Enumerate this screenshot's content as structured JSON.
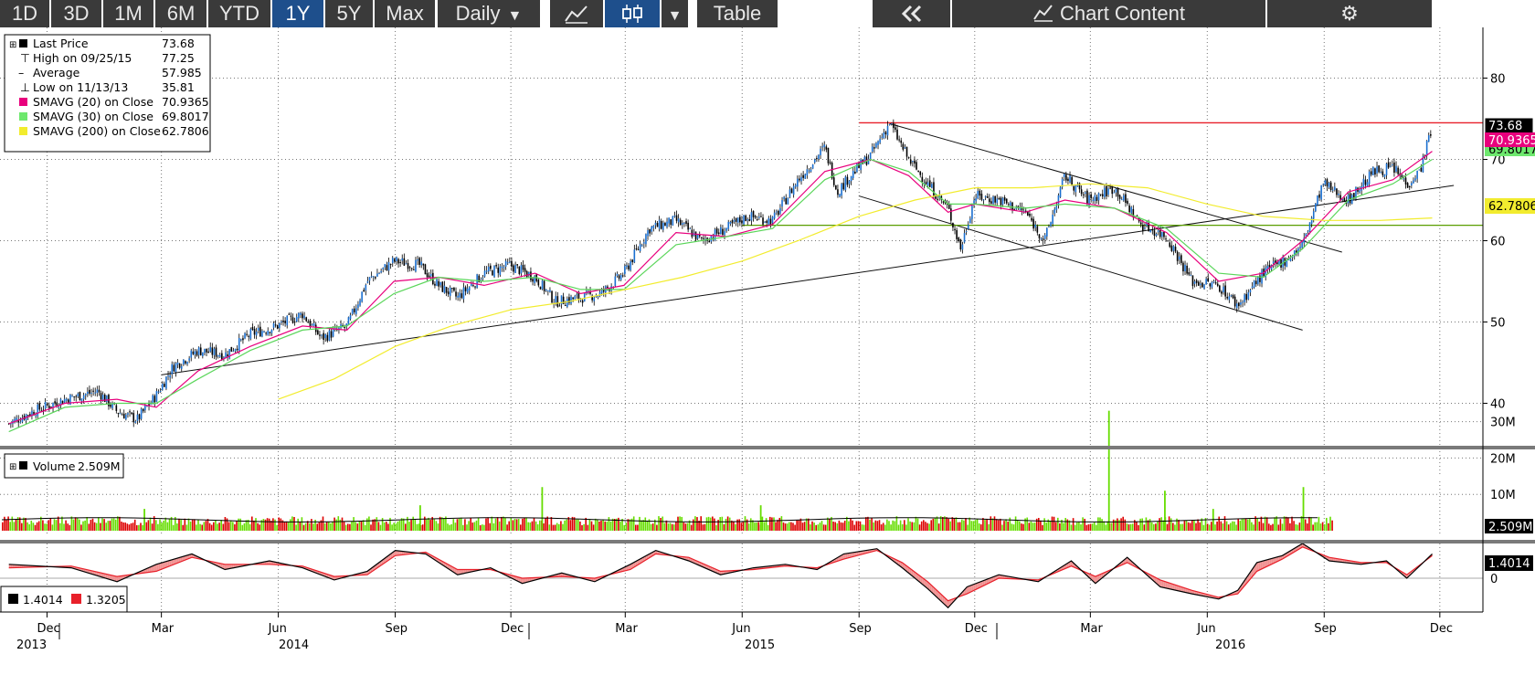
{
  "toolbar": {
    "ranges": [
      "1D",
      "3D",
      "1M",
      "6M",
      "YTD",
      "1Y",
      "5Y",
      "Max"
    ],
    "active_range": "1Y",
    "frequency": "Daily",
    "line_icon": "line-chart-icon",
    "candle_icon": "candlestick-icon",
    "dropdown_icon": "caret-down-icon",
    "table_label": "Table",
    "collapse_icon": "double-chevron-left-icon",
    "chart_content_label": "Chart Content",
    "chart_content_icon": "chart-icon",
    "settings_icon": "gear-icon"
  },
  "colors": {
    "price": "#000000",
    "sma20": "#e8007d",
    "sma30": "#5bd65b",
    "sma200": "#f2ec2e",
    "resistance": "#e8202a",
    "support": "#5a9e00",
    "macd": "#000000",
    "signal": "#e8202a",
    "volume_up": "#66dd00",
    "volume_down": "#dd0000"
  },
  "legend": {
    "last_price": {
      "label": "Last Price",
      "value": "73.68"
    },
    "high": {
      "label": "High on 09/25/15",
      "value": "77.25"
    },
    "average": {
      "label": "Average",
      "value": "57.985"
    },
    "low": {
      "label": "Low on 11/13/13",
      "value": "35.81"
    },
    "sma20": {
      "label": "SMAVG (20) on Close",
      "value": "70.9365"
    },
    "sma30": {
      "label": "SMAVG (30) on Close",
      "value": "69.8017"
    },
    "sma200": {
      "label": "SMAVG (200) on Close",
      "value": "62.7806"
    }
  },
  "volume_legend": {
    "label": "Volume",
    "value": "2.509M"
  },
  "macd_legend": {
    "macd_value": "1.4014",
    "signal_value": "1.3205"
  },
  "tags": {
    "last_price": "73.68",
    "sma20": "70.9365",
    "sma30": "69.8017",
    "sma200": "62.7806",
    "volume": "2.509M",
    "macd": "1.4014"
  },
  "chart_data": [
    {
      "type": "line",
      "panel": "price",
      "x_tick_labels": [
        "Dec",
        "Mar",
        "Jun",
        "Sep",
        "Dec",
        "Mar",
        "Jun",
        "Sep",
        "Dec",
        "Mar",
        "Jun",
        "Sep",
        "Dec"
      ],
      "year_labels": [
        "2013",
        "2014",
        "2015",
        "2016"
      ],
      "y_ticks": [
        40,
        50,
        60,
        70,
        80
      ],
      "ylim": [
        34,
        83
      ],
      "grid": true,
      "legend_position": "top-left",
      "series": [
        {
          "name": "Last Price",
          "color": "#000000",
          "x": [
            "2013-11-01",
            "2013-11-20",
            "2013-12-15",
            "2014-01-10",
            "2014-01-25",
            "2014-02-10",
            "2014-02-25",
            "2014-03-10",
            "2014-03-30",
            "2014-04-20",
            "2014-05-10",
            "2014-05-31",
            "2014-06-20",
            "2014-07-05",
            "2014-07-25",
            "2014-08-10",
            "2014-08-31",
            "2014-09-20",
            "2014-10-05",
            "2014-10-20",
            "2014-11-10",
            "2014-11-30",
            "2014-12-20",
            "2015-01-05",
            "2015-01-25",
            "2015-02-10",
            "2015-02-28",
            "2015-03-20",
            "2015-04-10",
            "2015-04-30",
            "2015-05-20",
            "2015-06-05",
            "2015-06-25",
            "2015-07-15",
            "2015-08-05",
            "2015-08-15",
            "2015-08-25",
            "2015-09-10",
            "2015-09-25",
            "2015-10-10",
            "2015-10-25",
            "2015-11-10",
            "2015-11-20",
            "2015-12-01",
            "2015-12-20",
            "2016-01-10",
            "2016-01-25",
            "2016-02-10",
            "2016-02-28",
            "2016-03-20",
            "2016-04-10",
            "2016-04-30",
            "2016-05-20",
            "2016-06-10",
            "2016-06-25",
            "2016-07-15",
            "2016-08-05",
            "2016-08-15",
            "2016-08-31",
            "2016-09-20",
            "2016-10-10",
            "2016-10-25",
            "2016-11-05",
            "2016-11-15",
            "2016-11-25"
          ],
          "values": [
            37.5,
            39,
            40.5,
            41.5,
            39,
            38,
            41,
            44.5,
            46.5,
            46,
            48.5,
            49.5,
            51,
            48,
            49.5,
            55,
            57.5,
            57,
            54.5,
            53,
            56,
            57,
            55.5,
            52.5,
            53,
            53.5,
            56,
            61.5,
            62.5,
            60,
            61.5,
            63,
            62.5,
            67.5,
            71.5,
            66,
            68,
            70.5,
            74.5,
            70,
            67,
            64,
            59,
            65.5,
            65,
            63.5,
            60,
            68,
            65,
            66.5,
            62,
            60.5,
            55,
            54.5,
            52,
            56,
            58,
            59.5,
            67,
            65,
            68.5,
            69,
            67,
            68.5,
            74
          ]
        },
        {
          "name": "SMAVG (20) on Close",
          "color": "#e8007d",
          "x": [
            "2013-11-01",
            "2013-12-15",
            "2014-01-25",
            "2014-02-25",
            "2014-03-30",
            "2014-05-10",
            "2014-06-20",
            "2014-07-25",
            "2014-08-31",
            "2014-10-05",
            "2014-11-10",
            "2014-12-20",
            "2015-01-25",
            "2015-02-28",
            "2015-04-10",
            "2015-05-20",
            "2015-06-25",
            "2015-08-05",
            "2015-09-10",
            "2015-10-10",
            "2015-11-10",
            "2015-12-01",
            "2016-01-10",
            "2016-02-10",
            "2016-03-20",
            "2016-04-30",
            "2016-06-10",
            "2016-07-15",
            "2016-08-15",
            "2016-09-20",
            "2016-10-25",
            "2016-11-25"
          ],
          "values": [
            37.5,
            40,
            40.5,
            39.5,
            44,
            47,
            49.5,
            49,
            55,
            55.5,
            54.5,
            56,
            53.5,
            54.5,
            61,
            60.5,
            62,
            68.5,
            70,
            68,
            63.5,
            64.5,
            63.5,
            65,
            64,
            61,
            55,
            56,
            60,
            66,
            67.5,
            71
          ]
        },
        {
          "name": "SMAVG (30) on Close",
          "color": "#5bd65b",
          "x": [
            "2013-11-01",
            "2013-12-15",
            "2014-01-25",
            "2014-02-25",
            "2014-03-30",
            "2014-05-10",
            "2014-06-20",
            "2014-07-25",
            "2014-08-31",
            "2014-10-05",
            "2014-11-10",
            "2014-12-20",
            "2015-01-25",
            "2015-02-28",
            "2015-04-10",
            "2015-05-20",
            "2015-06-25",
            "2015-08-05",
            "2015-09-10",
            "2015-10-10",
            "2015-11-10",
            "2015-12-01",
            "2016-01-10",
            "2016-02-10",
            "2016-03-20",
            "2016-04-30",
            "2016-06-10",
            "2016-07-15",
            "2016-08-15",
            "2016-09-20",
            "2016-10-25",
            "2016-11-25"
          ],
          "values": [
            36.5,
            39.5,
            40,
            40,
            43,
            46.5,
            49,
            49.5,
            53.5,
            55.5,
            55,
            55.5,
            54,
            54,
            59.5,
            60.5,
            61.5,
            67.5,
            70,
            68.5,
            64.5,
            64.5,
            64,
            64.5,
            64,
            61.5,
            56,
            55.5,
            59,
            65,
            67,
            70
          ]
        },
        {
          "name": "SMAVG (200) on Close",
          "color": "#f2ec2e",
          "x": [
            "2014-06-01",
            "2014-07-15",
            "2014-09-01",
            "2014-10-15",
            "2014-12-01",
            "2015-01-15",
            "2015-03-01",
            "2015-04-15",
            "2015-06-01",
            "2015-07-15",
            "2015-09-01",
            "2015-10-15",
            "2015-12-01",
            "2016-01-15",
            "2016-03-01",
            "2016-04-15",
            "2016-06-01",
            "2016-07-15",
            "2016-09-01",
            "2016-10-15",
            "2016-11-25"
          ],
          "values": [
            40.5,
            43,
            47,
            49.5,
            51.5,
            52.5,
            54,
            55.5,
            57.5,
            60,
            63,
            65,
            66.5,
            66.5,
            67,
            66.5,
            64.5,
            63,
            62.5,
            62.5,
            62.8
          ]
        }
      ],
      "annotations": {
        "trend_lines": [
          {
            "name": "support-uptrend",
            "x": [
              "2014-03-01",
              "2016-12-12"
            ],
            "y": [
              43.5,
              66.8
            ]
          },
          {
            "name": "channel-upper",
            "x": [
              "2015-09-25",
              "2016-09-15"
            ],
            "y": [
              74.4,
              58.6
            ]
          },
          {
            "name": "channel-lower",
            "x": [
              "2015-09-01",
              "2016-08-15"
            ],
            "y": [
              65.5,
              49
            ]
          }
        ],
        "horizontal_lines": [
          {
            "name": "resistance",
            "y": 74.5,
            "color": "#e8202a",
            "x_start": "2015-09-01"
          },
          {
            "name": "support",
            "y": 61.9,
            "color": "#5a9e00",
            "x_start": "2015-06-01"
          }
        ]
      }
    },
    {
      "type": "bar",
      "panel": "volume",
      "y_ticks": [
        "10M",
        "20M",
        "30M"
      ],
      "ylim": [
        0,
        35
      ],
      "series": [
        {
          "name": "Volume",
          "color": "#66dd00"
        }
      ],
      "spikes": {
        "x": [
          "2014-02-15",
          "2014-09-20",
          "2014-12-25",
          "2015-06-15",
          "2016-03-15",
          "2016-04-28",
          "2016-06-05",
          "2016-08-15"
        ],
        "values": [
          6,
          7,
          12,
          7,
          33,
          11,
          6,
          12
        ]
      },
      "typical_range": [
        1.5,
        4
      ]
    },
    {
      "type": "line",
      "panel": "macd",
      "y_ticks": [
        0
      ],
      "series": [
        {
          "name": "MACD",
          "color": "#000000",
          "x": [
            "2013-11-01",
            "2013-12-20",
            "2014-01-25",
            "2014-02-25",
            "2014-03-25",
            "2014-04-20",
            "2014-05-25",
            "2014-06-20",
            "2014-07-15",
            "2014-08-10",
            "2014-09-01",
            "2014-09-25",
            "2014-10-20",
            "2014-11-15",
            "2014-12-10",
            "2015-01-10",
            "2015-02-05",
            "2015-03-05",
            "2015-03-25",
            "2015-04-20",
            "2015-05-15",
            "2015-06-10",
            "2015-07-05",
            "2015-07-30",
            "2015-08-20",
            "2015-09-15",
            "2015-10-05",
            "2015-10-25",
            "2015-11-10",
            "2015-11-25",
            "2015-12-20",
            "2016-01-20",
            "2016-02-15",
            "2016-03-05",
            "2016-03-30",
            "2016-04-25",
            "2016-05-20",
            "2016-06-10",
            "2016-06-25",
            "2016-07-10",
            "2016-07-30",
            "2016-08-15",
            "2016-09-05",
            "2016-09-30",
            "2016-10-20",
            "2016-11-05",
            "2016-11-25"
          ],
          "values": [
            0.8,
            0.6,
            -0.2,
            0.8,
            1.4,
            0.5,
            1.0,
            0.6,
            -0.1,
            0.4,
            1.6,
            1.4,
            0.2,
            0.6,
            -0.3,
            0.3,
            -0.2,
            0.8,
            1.6,
            1.0,
            0.2,
            0.6,
            0.8,
            0.5,
            1.4,
            1.7,
            0.6,
            -0.6,
            -1.7,
            -0.5,
            0.2,
            -0.2,
            1.0,
            -0.3,
            1.2,
            -0.5,
            -0.9,
            -1.2,
            -0.7,
            0.9,
            1.3,
            2.0,
            1.0,
            0.8,
            1.0,
            0.0,
            1.4
          ]
        },
        {
          "name": "Signal",
          "color": "#e8202a",
          "x": [
            "2013-11-01",
            "2013-12-20",
            "2014-01-25",
            "2014-02-25",
            "2014-03-25",
            "2014-04-20",
            "2014-05-25",
            "2014-06-20",
            "2014-07-15",
            "2014-08-10",
            "2014-09-01",
            "2014-09-25",
            "2014-10-20",
            "2014-11-15",
            "2014-12-10",
            "2015-01-10",
            "2015-02-05",
            "2015-03-05",
            "2015-03-25",
            "2015-04-20",
            "2015-05-15",
            "2015-06-10",
            "2015-07-05",
            "2015-07-30",
            "2015-08-20",
            "2015-09-15",
            "2015-10-05",
            "2015-10-25",
            "2015-11-10",
            "2015-11-25",
            "2015-12-20",
            "2016-01-20",
            "2016-02-15",
            "2016-03-05",
            "2016-03-30",
            "2016-04-25",
            "2016-05-20",
            "2016-06-10",
            "2016-06-25",
            "2016-07-10",
            "2016-07-30",
            "2016-08-15",
            "2016-09-05",
            "2016-09-30",
            "2016-10-20",
            "2016-11-05",
            "2016-11-25"
          ],
          "values": [
            0.6,
            0.7,
            0.1,
            0.4,
            1.2,
            0.8,
            0.8,
            0.7,
            0.1,
            0.2,
            1.3,
            1.5,
            0.5,
            0.5,
            0.0,
            0.1,
            0.0,
            0.5,
            1.4,
            1.2,
            0.4,
            0.5,
            0.7,
            0.6,
            1.1,
            1.6,
            0.9,
            -0.2,
            -1.3,
            -0.9,
            0.0,
            -0.1,
            0.7,
            0.1,
            0.9,
            -0.1,
            -0.7,
            -1.1,
            -0.9,
            0.4,
            1.1,
            1.8,
            1.2,
            0.9,
            0.9,
            0.2,
            1.3
          ]
        }
      ]
    }
  ]
}
